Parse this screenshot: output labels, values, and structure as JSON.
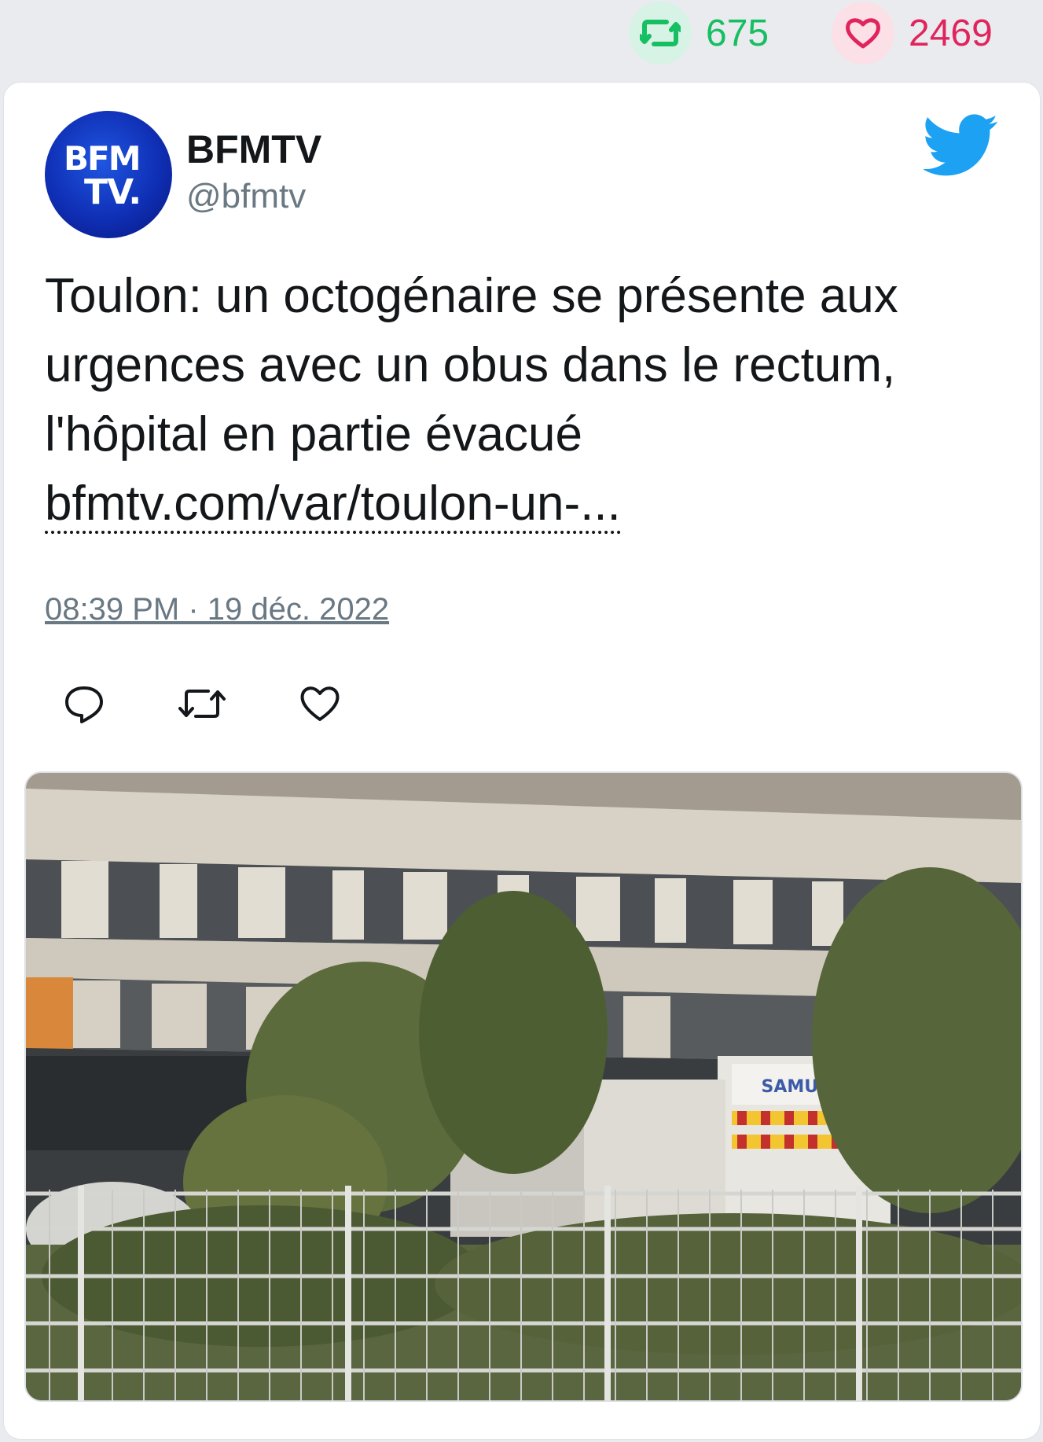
{
  "stats": {
    "retweets": "675",
    "likes": "2469",
    "retweet_icon": "retweet-icon",
    "like_icon": "heart-icon",
    "retweet_color": "#17bf63",
    "like_color": "#e0245e"
  },
  "tweet": {
    "author_name": "BFMTV",
    "author_handle": "@bfmtv",
    "avatar_text_line1": "BFM",
    "avatar_text_line2": "TV.",
    "text": "Toulon: un octogénaire se présente aux urgences avec un obus dans le rectum, l'hôpital en partie évacué ",
    "link_text": "bfmtv.com/var/toulon-un-...",
    "timestamp": "08:39 PM · 19 déc. 2022",
    "actions": [
      "reply-icon",
      "retweet-icon",
      "heart-icon"
    ],
    "brand_color": "#1da1f2"
  },
  "media": {
    "description_icon": "photo",
    "ambulance_label": "SAMU 83"
  }
}
